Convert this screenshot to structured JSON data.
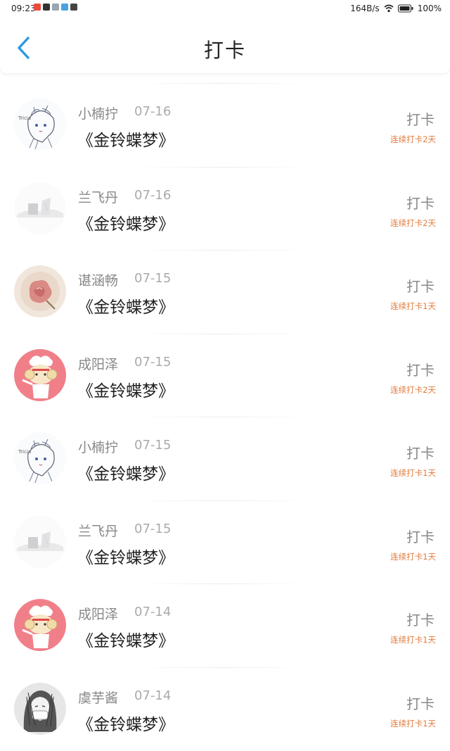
{
  "status_bar": {
    "time": "09:23",
    "net_speed": "164B/s",
    "battery": "100%",
    "notification_colors": [
      "#e94b3c",
      "#333333",
      "#9aa5b1",
      "#4aa3df",
      "#444444"
    ]
  },
  "header": {
    "title": "打卡",
    "back_icon": "chevron-left-icon",
    "accent_color": "#2a9be0"
  },
  "records": [
    {
      "name": "小楠拧",
      "date": "07-16",
      "book": "《金铃蝶梦》",
      "action": "打卡",
      "streak": "连续打卡2天",
      "avatar": "sketch-girl"
    },
    {
      "name": "兰飞丹",
      "date": "07-16",
      "book": "《金铃蝶梦》",
      "action": "打卡",
      "streak": "连续打卡2天",
      "avatar": "pale-landscape"
    },
    {
      "name": "谌涵畅",
      "date": "07-15",
      "book": "《金铃蝶梦》",
      "action": "打卡",
      "streak": "连续打卡1天",
      "avatar": "pink-flower"
    },
    {
      "name": "成阳泽",
      "date": "07-15",
      "book": "《金铃蝶梦》",
      "action": "打卡",
      "streak": "连续打卡2天",
      "avatar": "pink-chef-sheep"
    },
    {
      "name": "小楠拧",
      "date": "07-15",
      "book": "《金铃蝶梦》",
      "action": "打卡",
      "streak": "连续打卡1天",
      "avatar": "sketch-girl"
    },
    {
      "name": "兰飞丹",
      "date": "07-15",
      "book": "《金铃蝶梦》",
      "action": "打卡",
      "streak": "连续打卡1天",
      "avatar": "pale-landscape"
    },
    {
      "name": "成阳泽",
      "date": "07-14",
      "book": "《金铃蝶梦》",
      "action": "打卡",
      "streak": "连续打卡1天",
      "avatar": "pink-chef-sheep"
    },
    {
      "name": "虞芋酱",
      "date": "07-14",
      "book": "《金铃蝶梦》",
      "action": "打卡",
      "streak": "连续打卡1天",
      "avatar": "gray-sketch-person"
    }
  ],
  "colors": {
    "streak": "#e27a3a",
    "name": "#888888",
    "date": "#aaaaaa",
    "book": "#222222"
  }
}
